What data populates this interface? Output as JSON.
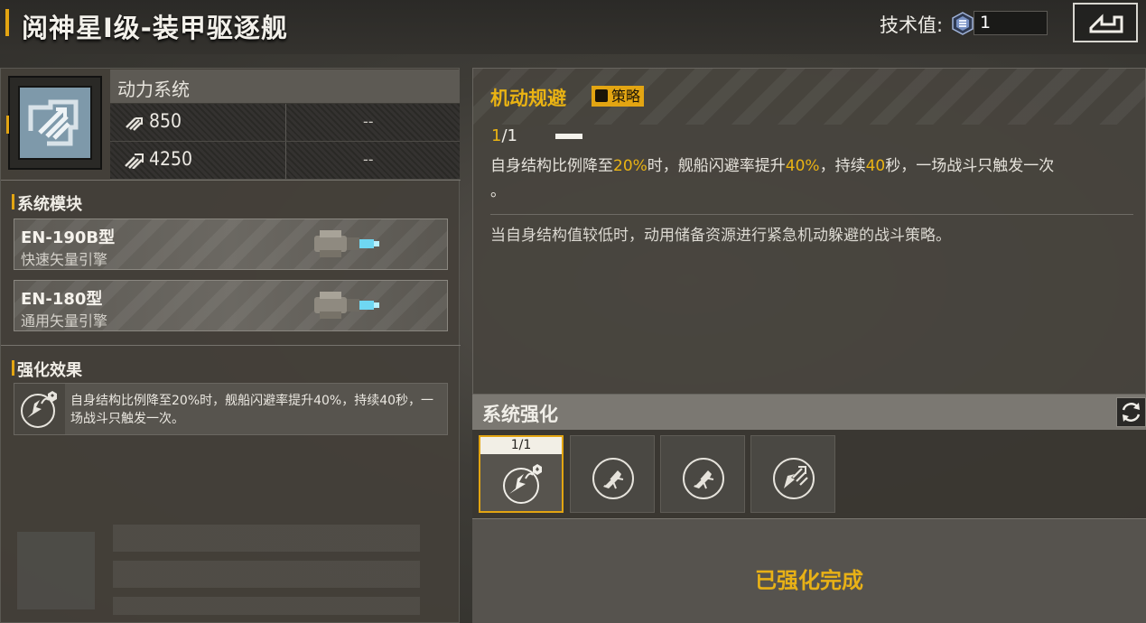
{
  "header": {
    "title": "阅神星I级-装甲驱逐舰",
    "tech_label": "技术值:",
    "tech_value": "1",
    "back_icon": "back-arrow-icon"
  },
  "power_system": {
    "title": "动力系统",
    "icon": "power-system-icon",
    "stats": [
      {
        "icon": "cruise-speed-icon",
        "value": "850",
        "extra": "--"
      },
      {
        "icon": "warp-speed-icon",
        "value": "4250",
        "extra": "--"
      }
    ]
  },
  "modules": {
    "heading": "系统模块",
    "items": [
      {
        "name": "EN-190B型",
        "desc": "快速矢量引擎",
        "icon": "engine-icon"
      },
      {
        "name": "EN-180型",
        "desc": "通用矢量引擎",
        "icon": "engine-icon"
      }
    ]
  },
  "effects": {
    "heading": "强化效果",
    "items": [
      {
        "icon": "evasion-strategy-icon",
        "text": "自身结构比例降至20%时，舰船闪避率提升40%，持续40秒，一场战斗只触发一次。"
      }
    ]
  },
  "skill": {
    "title": "机动规避",
    "tag": "策略",
    "level_current": "1",
    "level_sep": "/1",
    "progress": 1.0,
    "desc_parts": [
      "自身结构比例降至",
      "20%",
      "时，舰船闪避率提升",
      "40%",
      "，持续",
      "40",
      "秒，一场战斗只触发一次",
      "。"
    ],
    "flavor": "当自身结构值较低时，动用储备资源进行紧急机动躲避的战斗策略。"
  },
  "enhance": {
    "title": "系统强化",
    "refresh_icon": "refresh-icon",
    "slots": [
      {
        "level": "1/1",
        "icon": "evasion-strategy-icon",
        "active": true
      },
      {
        "icon": "ship-thrust-icon",
        "active": false
      },
      {
        "icon": "ship-thrust-icon",
        "active": false
      },
      {
        "icon": "ship-speed-icon",
        "active": false
      }
    ],
    "status": "已强化完成"
  },
  "colors": {
    "accent": "#e3a512",
    "highlight_text": "#eab313"
  }
}
